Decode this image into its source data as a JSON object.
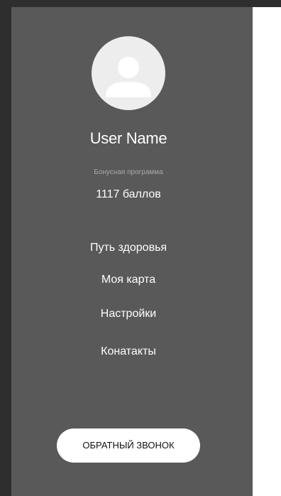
{
  "profile": {
    "avatar_icon": "user-avatar-icon",
    "user_name": "User Name"
  },
  "bonus": {
    "label": "Бонусная программа",
    "points": "1117 баллов"
  },
  "menu": {
    "items": [
      {
        "label": "Путь здоровья"
      },
      {
        "label": "Моя карта"
      },
      {
        "label": "Настройки"
      },
      {
        "label": "Конатакты"
      }
    ]
  },
  "callback": {
    "label": "ОБРАТНЫЙ ЗВОНОК"
  },
  "colors": {
    "drawer_background": "#595959",
    "page_background": "#2e2e2e",
    "avatar_background": "#ededed",
    "avatar_figure": "#ffffff",
    "button_background": "#ffffff",
    "muted_text": "#a9a9a9"
  }
}
